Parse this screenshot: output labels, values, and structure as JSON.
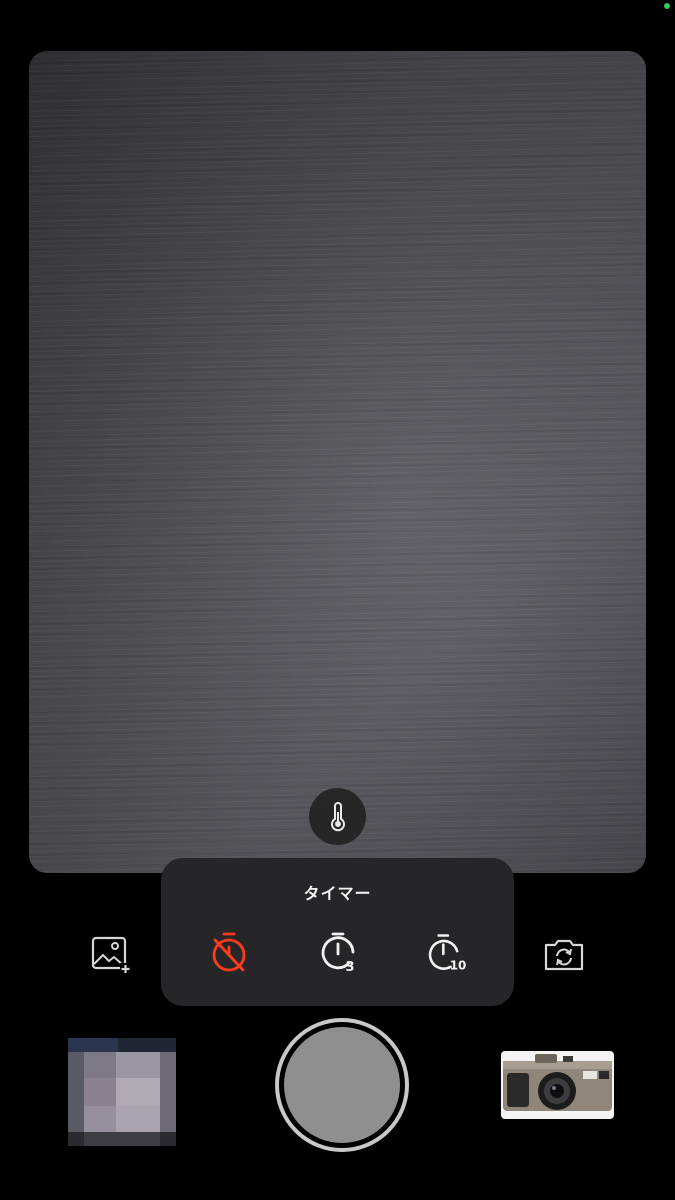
{
  "status": {
    "indicator_color": "#34c759"
  },
  "viewfinder": {
    "control_icon": "thermometer-icon"
  },
  "timer_panel": {
    "title": "タイマー",
    "options": [
      {
        "id": "off",
        "icon": "timer-off-icon",
        "label": "",
        "selected": true,
        "color": "#ff3b1f"
      },
      {
        "id": "3s",
        "icon": "timer-icon",
        "label": "3",
        "selected": false,
        "color": "#f2f2f2"
      },
      {
        "id": "10s",
        "icon": "timer-icon",
        "label": "10",
        "selected": false,
        "color": "#f2f2f2"
      }
    ]
  },
  "toolbar": {
    "left_icon": "add-photo-icon",
    "right_icon": "flip-camera-icon"
  },
  "bottom_bar": {
    "gallery_icon": "gallery-thumbnail",
    "shutter_icon": "shutter-button",
    "camera_model_icon": "film-camera-thumbnail"
  }
}
